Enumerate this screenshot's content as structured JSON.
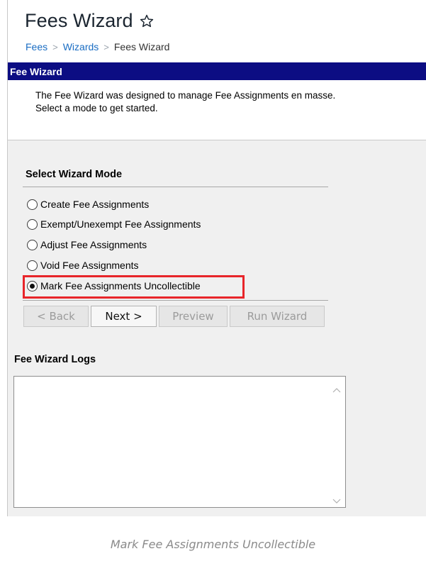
{
  "header": {
    "title": "Fees Wizard",
    "breadcrumb": [
      "Fees",
      "Wizards",
      "Fees Wizard"
    ]
  },
  "panel": {
    "title": "Fee Wizard",
    "intro_line1": "The Fee Wizard was designed to manage Fee Assignments en masse.",
    "intro_line2": "Select a mode to get started."
  },
  "mode": {
    "heading": "Select Wizard Mode",
    "options": [
      {
        "label": "Create Fee Assignments",
        "checked": false
      },
      {
        "label": "Exempt/Unexempt Fee Assignments",
        "checked": false
      },
      {
        "label": "Adjust Fee Assignments",
        "checked": false
      },
      {
        "label": "Void Fee Assignments",
        "checked": false
      },
      {
        "label": "Mark Fee Assignments Uncollectible",
        "checked": true
      }
    ]
  },
  "buttons": {
    "back": "< Back",
    "next": "Next >",
    "preview": "Preview",
    "run": "Run Wizard"
  },
  "logs": {
    "heading": "Fee Wizard Logs",
    "content": ""
  },
  "caption": "Mark Fee Assignments Uncollectible",
  "colors": {
    "header_bar": "#0c0d83",
    "link": "#1a6dc3",
    "highlight": "#e8252a"
  }
}
